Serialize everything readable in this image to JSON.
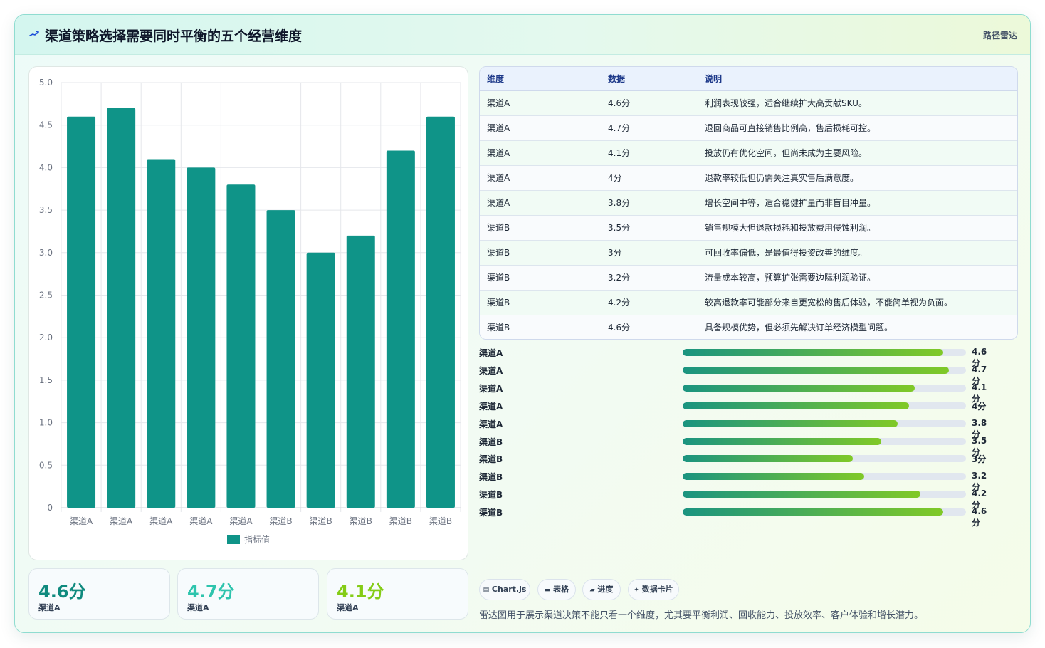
{
  "header": {
    "title": "渠道策略选择需要同时平衡的五个经营维度",
    "tag": "路径雷达",
    "icon": "trend-arrow-icon"
  },
  "chart_data": {
    "type": "bar",
    "categories": [
      "渠道A",
      "渠道A",
      "渠道A",
      "渠道A",
      "渠道A",
      "渠道B",
      "渠道B",
      "渠道B",
      "渠道B",
      "渠道B"
    ],
    "series": [
      {
        "name": "指标值",
        "values": [
          4.6,
          4.7,
          4.1,
          4.0,
          3.8,
          3.5,
          3.0,
          3.2,
          4.2,
          4.6
        ]
      }
    ],
    "ylim": [
      0,
      5
    ],
    "yticks": [
      "0",
      "0.5",
      "1.0",
      "1.5",
      "2.0",
      "2.5",
      "3.0",
      "3.5",
      "4.0",
      "4.5",
      "5.0"
    ],
    "grid": true,
    "legend": "bottom",
    "color": "#0f9488"
  },
  "stats": [
    {
      "value": "4.6分",
      "label": "渠道A",
      "color": "#0f8a7e"
    },
    {
      "value": "4.7分",
      "label": "渠道A",
      "color": "#2ec4ad"
    },
    {
      "value": "4.1分",
      "label": "渠道A",
      "color": "#84cc16"
    }
  ],
  "table": {
    "headers": [
      "维度",
      "数据",
      "说明"
    ],
    "rows": [
      {
        "dim": "渠道A",
        "value": "4.6分",
        "note": "利润表现较强，适合继续扩大高贡献SKU。"
      },
      {
        "dim": "渠道A",
        "value": "4.7分",
        "note": "退回商品可直接销售比例高，售后损耗可控。"
      },
      {
        "dim": "渠道A",
        "value": "4.1分",
        "note": "投放仍有优化空间，但尚未成为主要风险。"
      },
      {
        "dim": "渠道A",
        "value": "4分",
        "note": "退款率较低但仍需关注真实售后满意度。"
      },
      {
        "dim": "渠道A",
        "value": "3.8分",
        "note": "增长空间中等，适合稳健扩量而非盲目冲量。"
      },
      {
        "dim": "渠道B",
        "value": "3.5分",
        "note": "销售规模大但退款损耗和投放费用侵蚀利润。"
      },
      {
        "dim": "渠道B",
        "value": "3分",
        "note": "可回收率偏低，是最值得投资改善的维度。"
      },
      {
        "dim": "渠道B",
        "value": "3.2分",
        "note": "流量成本较高，预算扩张需要边际利润验证。"
      },
      {
        "dim": "渠道B",
        "value": "4.2分",
        "note": "较高退款率可能部分来自更宽松的售后体验，不能简单视为负面。"
      },
      {
        "dim": "渠道B",
        "value": "4.6分",
        "note": "具备规模优势，但必须先解决订单经济模型问题。"
      }
    ]
  },
  "progress": [
    {
      "label": "渠道A",
      "value": "4.6分",
      "fraction": 0.92
    },
    {
      "label": "渠道A",
      "value": "4.7分",
      "fraction": 0.94
    },
    {
      "label": "渠道A",
      "value": "4.1分",
      "fraction": 0.82
    },
    {
      "label": "渠道A",
      "value": "4分",
      "fraction": 0.8
    },
    {
      "label": "渠道A",
      "value": "3.8分",
      "fraction": 0.76
    },
    {
      "label": "渠道B",
      "value": "3.5分",
      "fraction": 0.7
    },
    {
      "label": "渠道B",
      "value": "3分",
      "fraction": 0.6
    },
    {
      "label": "渠道B",
      "value": "3.2分",
      "fraction": 0.64
    },
    {
      "label": "渠道B",
      "value": "4.2分",
      "fraction": 0.84
    },
    {
      "label": "渠道B",
      "value": "4.6分",
      "fraction": 0.92
    }
  ],
  "chips": [
    {
      "icon": "▤",
      "label": "Chart.js"
    },
    {
      "icon": "▬",
      "label": "表格"
    },
    {
      "icon": "▰",
      "label": "进度"
    },
    {
      "icon": "✦",
      "label": "数据卡片"
    }
  ],
  "footnote": "雷达图用于展示渠道决策不能只看一个维度，尤其要平衡利润、回收能力、投放效率、客户体验和增长潜力。"
}
